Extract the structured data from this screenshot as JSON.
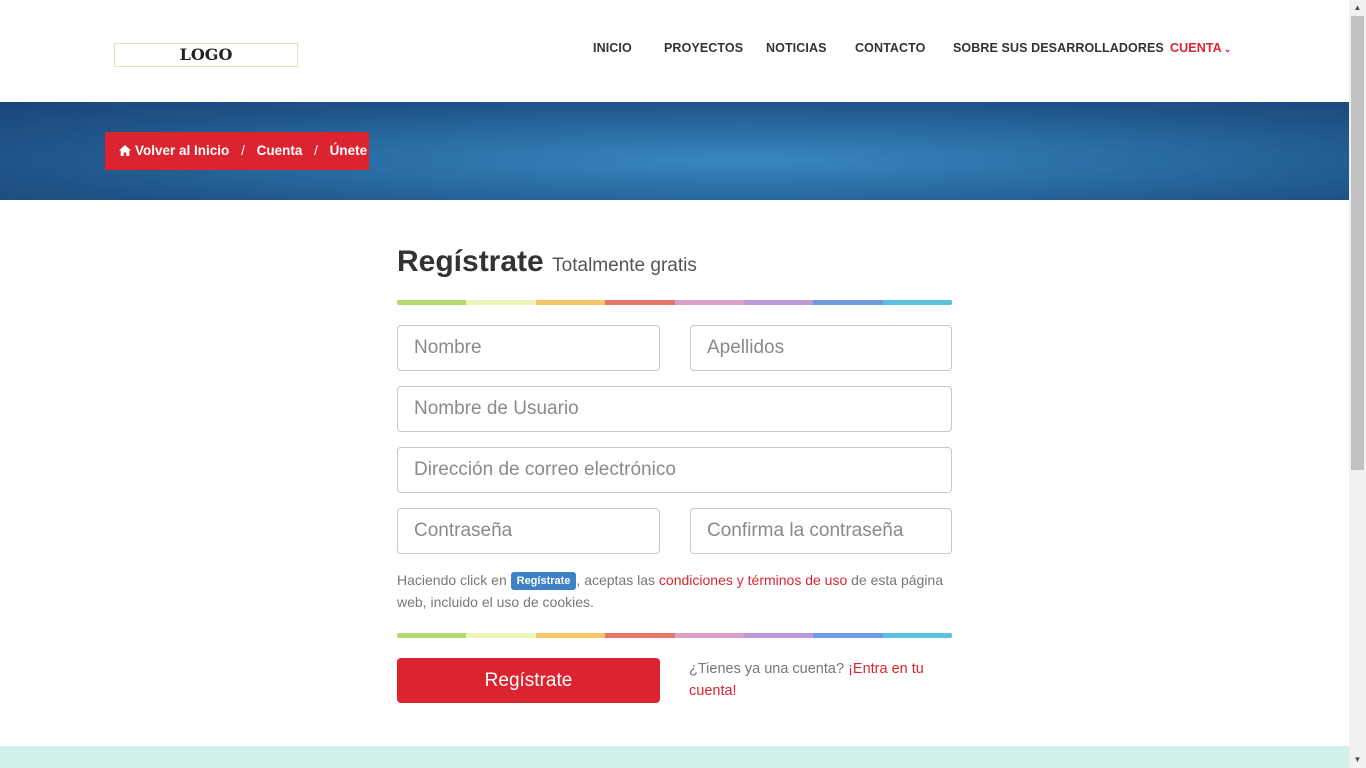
{
  "header": {
    "logo_text": "LOGO",
    "nav": [
      {
        "label": "INICIO"
      },
      {
        "label": "PROYECTOS"
      },
      {
        "label": "NOTICIAS"
      },
      {
        "label": "CONTACTO"
      },
      {
        "label": "SOBRE SUS DESARROLLADORES"
      },
      {
        "label": "CUENTA",
        "active": true,
        "icon": "chevron-down-icon"
      }
    ]
  },
  "breadcrumb": {
    "home_icon": "home-icon",
    "home": "Volver al Inicio",
    "separator": "/",
    "account": "Cuenta",
    "current": "Únete"
  },
  "form": {
    "title": "Regístrate",
    "subtitle": "Totalmente gratis",
    "first_name_placeholder": "Nombre",
    "last_name_placeholder": "Apellidos",
    "username_placeholder": "Nombre de Usuario",
    "email_placeholder": "Dirección de correo electrónico",
    "password_placeholder": "Contraseña",
    "confirm_password_placeholder": "Confirma la contraseña",
    "terms_prefix": "Haciendo click en",
    "terms_badge": "Regístrate",
    "terms_middle": ", aceptas las",
    "terms_link": "condiciones y términos de uso",
    "terms_suffix": "de esta página web, incluido el uso de cookies.",
    "submit_label": "Regístrate",
    "login_prompt": "¿Tienes ya una cuenta?",
    "login_link": "¡Entra en tu cuenta!"
  },
  "colors": {
    "accent_red": "#dc2431",
    "banner_blue": "#2a6fa6",
    "badge_blue": "#3d82c4",
    "footer_mint": "#d2f0ec",
    "rainbow": [
      "#b4d96e",
      "#eef5b8",
      "#f6c766",
      "#e8756a",
      "#d9a0c8",
      "#bf9ad9",
      "#6e9be0",
      "#5bc1e0"
    ]
  }
}
